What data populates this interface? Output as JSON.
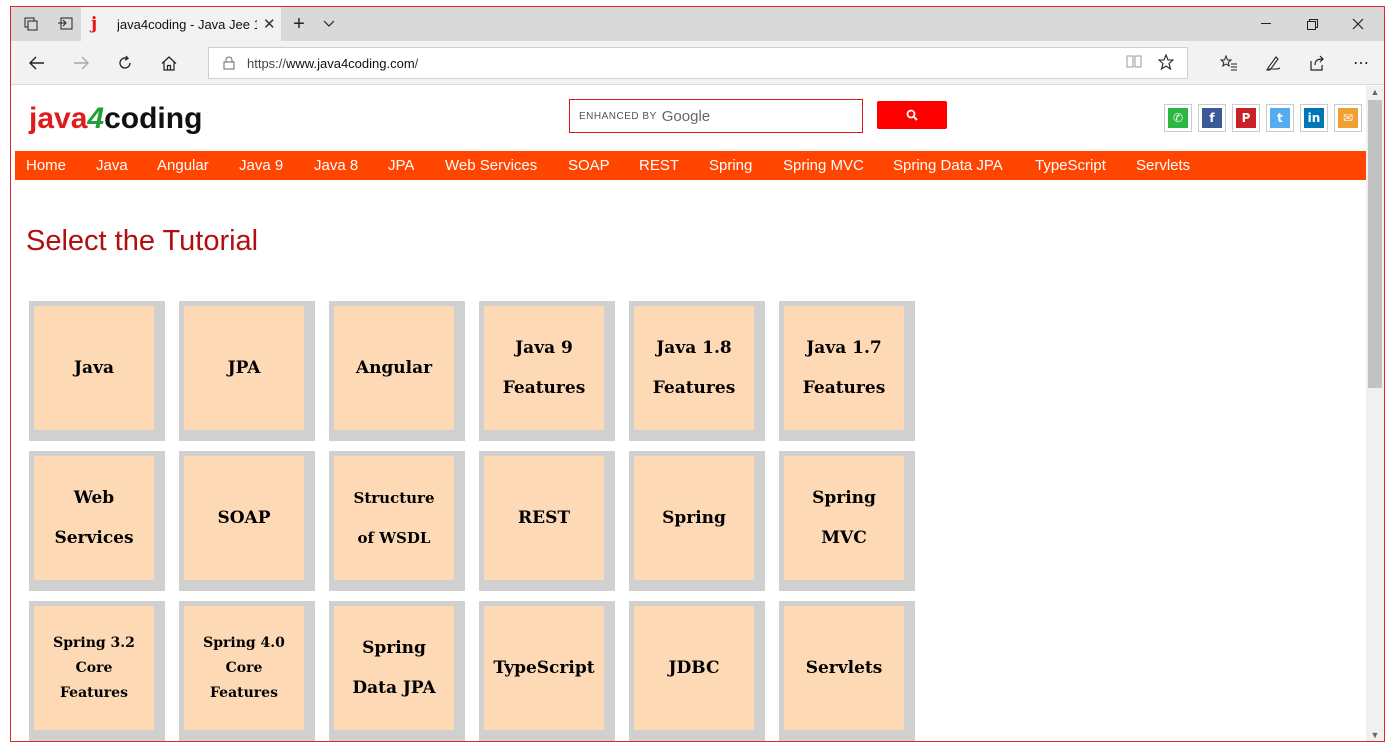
{
  "browser": {
    "tab_title": "java4coding - Java Jee 1",
    "favicon_letter": "j",
    "url_scheme": "https://",
    "url_host": "www.java4coding.com",
    "url_path": "/",
    "new_tab_symbol": "+",
    "tab_list_symbol": "⌵"
  },
  "site": {
    "logo": {
      "part1": "java",
      "part2": "4",
      "part3": "coding"
    },
    "search": {
      "enhanced": "ENHANCED BY",
      "google": "Google"
    },
    "social": [
      {
        "name": "whatsapp",
        "glyph": "✆",
        "color": "#2bb741"
      },
      {
        "name": "facebook",
        "glyph": "f",
        "color": "#3b5998"
      },
      {
        "name": "pinterest",
        "glyph": "P",
        "color": "#cb2027"
      },
      {
        "name": "twitter",
        "glyph": "t",
        "color": "#55acee"
      },
      {
        "name": "linkedin",
        "glyph": "in",
        "color": "#0077b5"
      },
      {
        "name": "email",
        "glyph": "✉",
        "color": "#f0a030"
      }
    ],
    "menu": [
      "Home",
      "Java",
      "Angular",
      "Java 9",
      "Java 8",
      "JPA",
      "Web Services",
      "SOAP",
      "REST",
      "Spring",
      "Spring MVC",
      "Spring Data JPA",
      "TypeScript",
      "Servlets"
    ],
    "heading": "Select the Tutorial",
    "cards": [
      "Java",
      "JPA",
      "Angular",
      "Java 9\nFeatures",
      "Java 1.8\nFeatures",
      "Java 1.7\nFeatures",
      "Web\nServices",
      "SOAP",
      "Structure\nof WSDL",
      "REST",
      "Spring",
      "Spring\nMVC",
      "Spring 3.2\nCore\nFeatures",
      "Spring 4.0\nCore\nFeatures",
      "Spring\nData JPA",
      "TypeScript",
      "JDBC",
      "Servlets"
    ]
  }
}
